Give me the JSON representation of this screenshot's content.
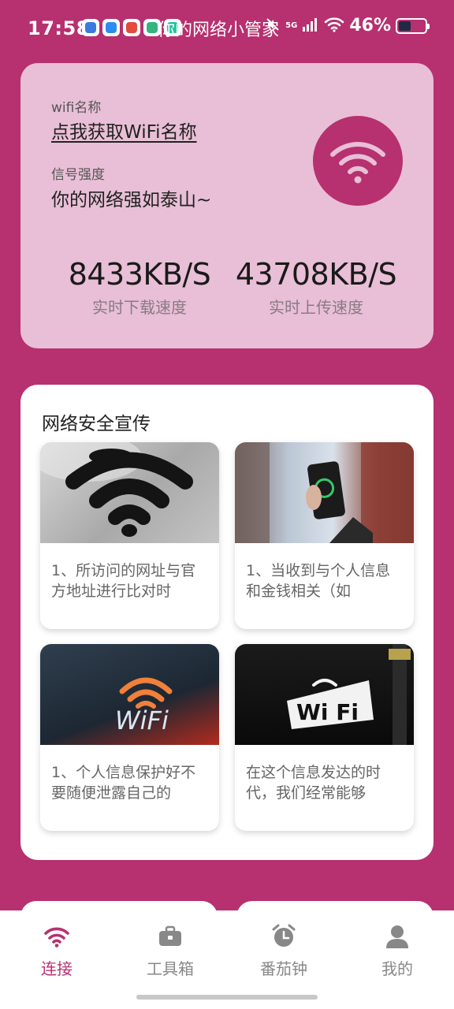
{
  "status_bar": {
    "time": "17:58",
    "overlay_title": "你的网络小管家",
    "network": "5G",
    "battery": "46%",
    "battery_level": 0.46
  },
  "info_card": {
    "wifi_name_label": "wifi名称",
    "wifi_name_link": "点我获取WiFi名称",
    "signal_label": "信号强度",
    "signal_value": "你的网络强如泰山~",
    "download_speed": "8433KB/S",
    "download_label": "实时下载速度",
    "upload_speed": "43708KB/S",
    "upload_label": "实时上传速度",
    "icon": "wifi-icon"
  },
  "security": {
    "title": "网络安全宣传",
    "articles": [
      {
        "text": "1、所访问的网址与官方地址进行比对时",
        "image": "wifi-drain-image"
      },
      {
        "text": "1、当收到与个人信息和金钱相关（如",
        "image": "phone-speedtest-image"
      },
      {
        "text": "1、个人信息保护好不要随便泄露自己的",
        "image": "wifi-sign-image"
      },
      {
        "text": "在这个信息发达的时代，我们经常能够",
        "image": "wifi-free-sign-image"
      }
    ]
  },
  "nav": {
    "items": [
      {
        "label": "连接",
        "icon": "wifi-icon",
        "active": true
      },
      {
        "label": "工具箱",
        "icon": "toolbox-icon",
        "active": false
      },
      {
        "label": "番茄钟",
        "icon": "alarm-clock-icon",
        "active": false
      },
      {
        "label": "我的",
        "icon": "user-icon",
        "active": false
      }
    ]
  },
  "colors": {
    "brand": "#b7306f",
    "card_pink": "#e8bfd6",
    "nav_active": "#b7306f"
  }
}
